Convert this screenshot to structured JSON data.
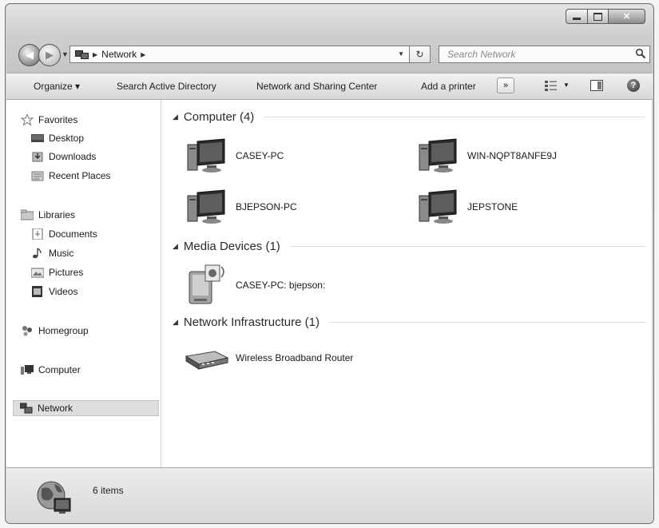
{
  "address": {
    "path": [
      "Network"
    ],
    "search_placeholder": "Search Network"
  },
  "toolbar": {
    "organize": "Organize ▾",
    "search_ad": "Search Active Directory",
    "network_sharing": "Network and Sharing Center",
    "add_printer": "Add a printer",
    "more": "»"
  },
  "sidebar": {
    "favorites": "Favorites",
    "desktop": "Desktop",
    "downloads": "Downloads",
    "recent_places": "Recent Places",
    "libraries": "Libraries",
    "documents": "Documents",
    "music": "Music",
    "pictures": "Pictures",
    "videos": "Videos",
    "homegroup": "Homegroup",
    "computer": "Computer",
    "network": "Network"
  },
  "groups": {
    "computer": "Computer (4)",
    "media": "Media Devices (1)",
    "infrastructure": "Network Infrastructure (1)"
  },
  "items": {
    "casey_pc": "CASEY-PC",
    "win_nqpt": "WIN-NQPT8ANFE9J",
    "bjepson_pc": "BJEPSON-PC",
    "jepstone": "JEPSTONE",
    "casey_media": "CASEY-PC: bjepson:",
    "router": "Wireless Broadband Router"
  },
  "status": {
    "count": "6 items"
  }
}
